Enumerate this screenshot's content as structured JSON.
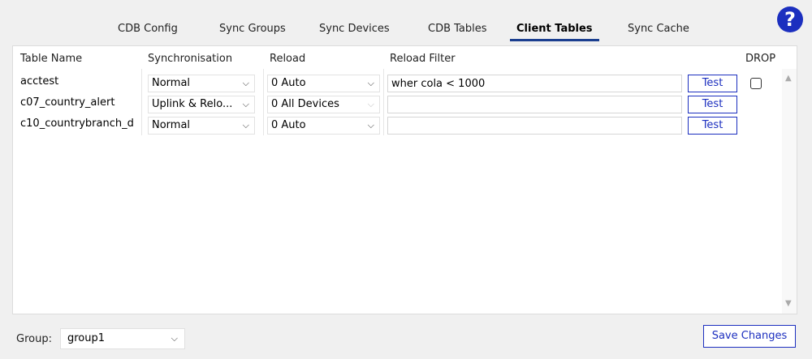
{
  "tabs": [
    {
      "label": "CDB Config"
    },
    {
      "label": "Sync Groups"
    },
    {
      "label": "Sync Devices"
    },
    {
      "label": "CDB Tables"
    },
    {
      "label": "Client Tables",
      "active": true
    },
    {
      "label": "Sync Cache"
    }
  ],
  "help_label": "?",
  "table": {
    "columns": {
      "name": "Table Name",
      "sync": "Synchronisation",
      "reload": "Reload",
      "filter": "Reload Filter",
      "drop": "DROP"
    },
    "rows": [
      {
        "name": "acctest",
        "sync": "Normal",
        "reload": "0 Auto",
        "filter": "wher cola < 1000",
        "test": "Test",
        "drop": false
      },
      {
        "name": "c07_country_alert",
        "sync": "Uplink & Relo...",
        "reload": "0 All Devices",
        "filter": "",
        "test": "Test",
        "drop": null
      },
      {
        "name": "c10_countrybranch_d",
        "sync": "Normal",
        "reload": "0 Auto",
        "filter": "",
        "test": "Test",
        "drop": null
      }
    ]
  },
  "footer": {
    "group_label": "Group:",
    "group_value": "group1",
    "save_label": "Save Changes"
  },
  "colors": {
    "accent": "#1c2fbf",
    "tab_underline": "#1a3e8f"
  }
}
